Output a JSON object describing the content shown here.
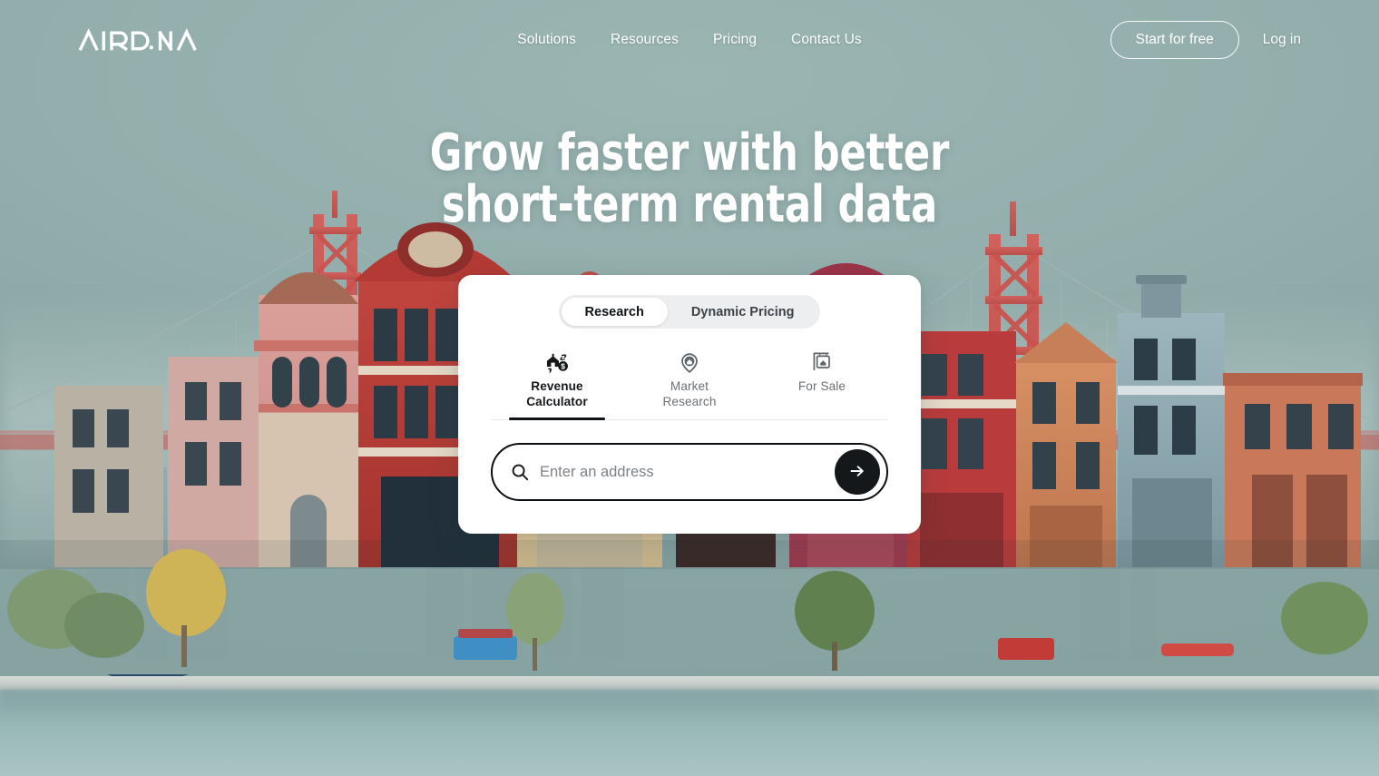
{
  "brand": {
    "name": "AIRDNA",
    "logo_icon": "airdna-wordmark"
  },
  "nav": {
    "links": [
      {
        "label": "Solutions"
      },
      {
        "label": "Resources"
      },
      {
        "label": "Pricing"
      },
      {
        "label": "Contact Us"
      }
    ],
    "cta_label": "Start for free",
    "login_label": "Log in"
  },
  "hero": {
    "line1": "Grow faster with better",
    "line2": "short-term rental data"
  },
  "card": {
    "segment": {
      "options": [
        {
          "label": "Research",
          "active": true
        },
        {
          "label": "Dynamic Pricing",
          "active": false
        }
      ]
    },
    "tabs": [
      {
        "label_line1": "Revenue",
        "label_line2": "Calculator",
        "icon": "house-dollar-icon",
        "active": true
      },
      {
        "label_line1": "Market",
        "label_line2": "Research",
        "icon": "map-pin-house-icon",
        "active": false
      },
      {
        "label_line1": "For Sale",
        "label_line2": "",
        "icon": "for-sale-sign-icon",
        "active": false
      }
    ],
    "search": {
      "placeholder": "Enter an address",
      "value": "",
      "icon": "search-icon",
      "submit_icon": "arrow-right-icon"
    }
  },
  "theme": {
    "sky": "#8ba7a5",
    "card_bg": "#ffffff",
    "accent_dark": "#15181b",
    "bridge_red": "#c9524e",
    "water": "#9dbbbb"
  },
  "scene": {
    "description": "Miniature San Francisco cityscape with Golden Gate Bridge and Victorian row houses over water"
  }
}
